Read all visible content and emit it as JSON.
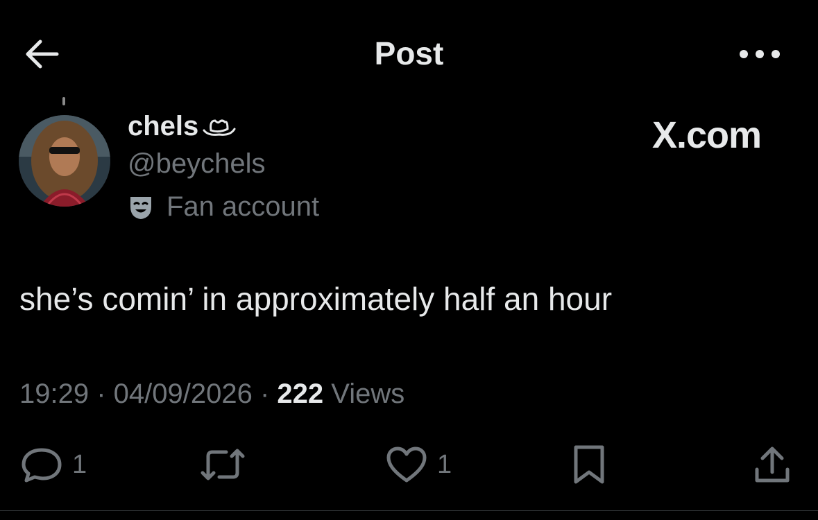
{
  "header": {
    "title": "Post"
  },
  "author": {
    "display_name": "chels",
    "handle": "@beychels",
    "label": "Fan account"
  },
  "watermark": "X.com",
  "post": {
    "text": "she’s comin’ in approximately half an hour"
  },
  "meta": {
    "time": "19:29",
    "date": "04/09/2026",
    "views_count": "222",
    "views_label": "Views",
    "separator": " · "
  },
  "actions": {
    "reply_count": "1",
    "like_count": "1"
  },
  "colors": {
    "background": "#000000",
    "primary_text": "#e7e9ea",
    "secondary_text": "#71767b"
  },
  "icons": [
    "back-arrow-icon",
    "more-icon",
    "cowboy-hat-icon",
    "theater-mask-icon",
    "reply-icon",
    "repost-icon",
    "like-icon",
    "bookmark-icon",
    "share-icon"
  ]
}
